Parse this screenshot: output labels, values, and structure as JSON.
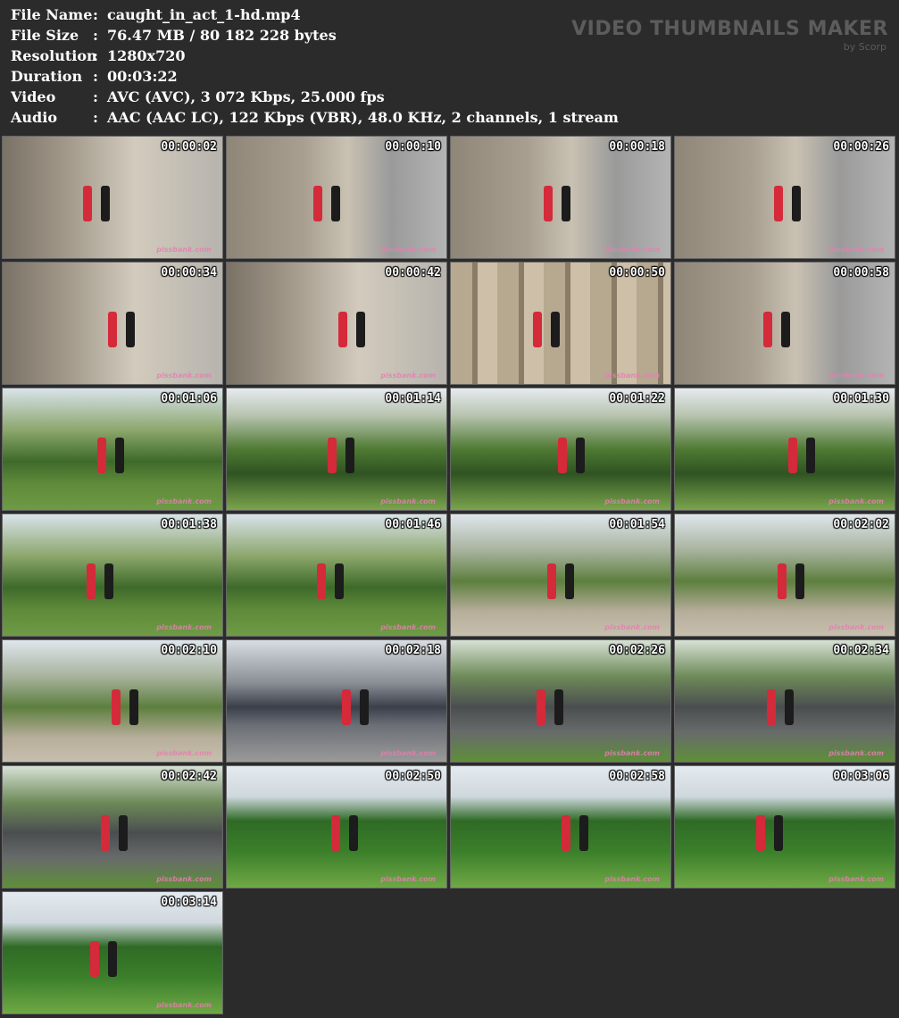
{
  "info": [
    {
      "label": "File Name",
      "value": "caught_in_act_1-hd.mp4"
    },
    {
      "label": "File Size",
      "value": "76.47 MB  / 80 182 228  bytes"
    },
    {
      "label": "Resolution",
      "value": "1280x720"
    },
    {
      "label": "Duration",
      "value": "00:03:22"
    },
    {
      "label": "Video",
      "value": "AVC (AVC), 3 072 Kbps, 25.000 fps"
    },
    {
      "label": "Audio",
      "value": "AAC (AAC LC), 122 Kbps (VBR), 48.0 KHz, 2 channels, 1 stream"
    }
  ],
  "colon": ":",
  "watermark": {
    "title": "VIDEO THUMBNAILS MAKER",
    "subtitle": "by Scorp"
  },
  "thumb_watermark": "pissbank.com",
  "thumbnails": [
    {
      "time": "00:00:02",
      "scene": "street-b"
    },
    {
      "time": "00:00:10",
      "scene": "street"
    },
    {
      "time": "00:00:18",
      "scene": "street"
    },
    {
      "time": "00:00:26",
      "scene": "street"
    },
    {
      "time": "00:00:34",
      "scene": "street-b"
    },
    {
      "time": "00:00:42",
      "scene": "street-b"
    },
    {
      "time": "00:00:50",
      "scene": "facade"
    },
    {
      "time": "00:00:58",
      "scene": "street"
    },
    {
      "time": "00:01:06",
      "scene": "park"
    },
    {
      "time": "00:01:14",
      "scene": "park-b"
    },
    {
      "time": "00:01:22",
      "scene": "park-b"
    },
    {
      "time": "00:01:30",
      "scene": "park-b"
    },
    {
      "time": "00:01:38",
      "scene": "park"
    },
    {
      "time": "00:01:46",
      "scene": "park"
    },
    {
      "time": "00:01:54",
      "scene": "plaza"
    },
    {
      "time": "00:02:02",
      "scene": "plaza"
    },
    {
      "time": "00:02:10",
      "scene": "plaza"
    },
    {
      "time": "00:02:18",
      "scene": "blur"
    },
    {
      "time": "00:02:26",
      "scene": "monument"
    },
    {
      "time": "00:02:34",
      "scene": "monument"
    },
    {
      "time": "00:02:42",
      "scene": "monument"
    },
    {
      "time": "00:02:50",
      "scene": "bush"
    },
    {
      "time": "00:02:58",
      "scene": "bush"
    },
    {
      "time": "00:03:06",
      "scene": "bush"
    },
    {
      "time": "00:03:14",
      "scene": "bush"
    }
  ]
}
